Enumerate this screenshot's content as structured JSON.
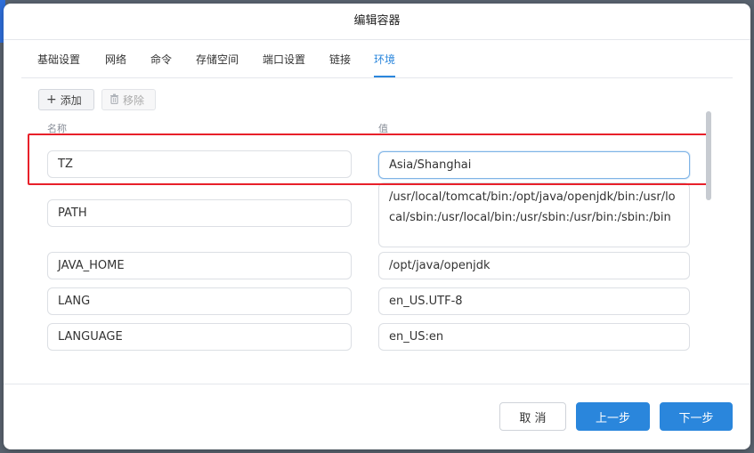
{
  "dialog": {
    "title": "编辑容器"
  },
  "tabs": [
    {
      "label": "基础设置",
      "active": false
    },
    {
      "label": "网络",
      "active": false
    },
    {
      "label": "命令",
      "active": false
    },
    {
      "label": "存储空间",
      "active": false
    },
    {
      "label": "端口设置",
      "active": false
    },
    {
      "label": "链接",
      "active": false
    },
    {
      "label": "环境",
      "active": true
    }
  ],
  "toolbar": {
    "add_label": "添加",
    "remove_label": "移除"
  },
  "columns": {
    "name": "名称",
    "value": "值"
  },
  "env_rows": [
    {
      "name": "TZ",
      "value": "Asia/Shanghai"
    },
    {
      "name": "PATH",
      "value": "/usr/local/tomcat/bin:/opt/java/openjdk/bin:/usr/local/sbin:/usr/local/bin:/usr/sbin:/usr/bin:/sbin:/bin"
    },
    {
      "name": "JAVA_HOME",
      "value": "/opt/java/openjdk"
    },
    {
      "name": "LANG",
      "value": "en_US.UTF-8"
    },
    {
      "name": "LANGUAGE",
      "value": "en_US:en"
    },
    {
      "name": "",
      "value": ""
    }
  ],
  "footer": {
    "cancel_label": "取 消",
    "prev_label": "上一步",
    "next_label": "下一步"
  },
  "colors": {
    "accent": "#2a86dc",
    "highlight": "#e8202a"
  },
  "icons": {
    "add": "plus-icon",
    "remove": "trash-icon"
  }
}
